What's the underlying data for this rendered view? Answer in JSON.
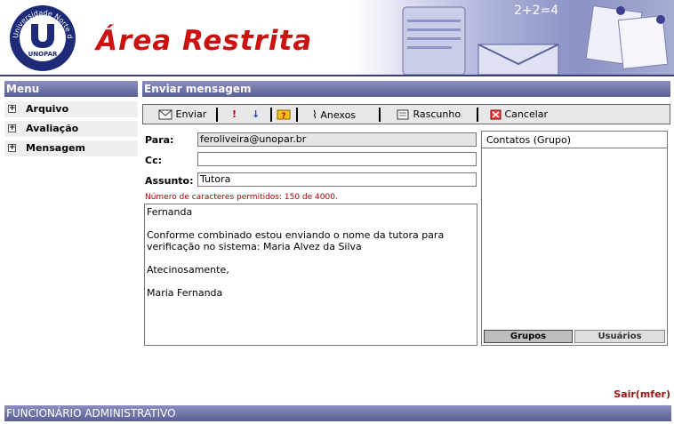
{
  "header": {
    "title": "Área Restrita",
    "logo": {
      "ring_text": "Universidade Norte do Paraná",
      "letter": "U",
      "name": "UNOPAR"
    }
  },
  "sidebar": {
    "title": "Menu",
    "items": [
      {
        "label": "Arquivo",
        "icon": "plus-box-icon"
      },
      {
        "label": "Avaliação",
        "icon": "plus-box-icon"
      },
      {
        "label": "Mensagem",
        "icon": "plus-box-icon"
      }
    ]
  },
  "section": {
    "title": "Enviar mensagem"
  },
  "toolbar": {
    "send_label": "Enviar",
    "attach_label": "Anexos",
    "draft_label": "Rascunho",
    "cancel_label": "Cancelar"
  },
  "form": {
    "to_label": "Para:",
    "to_value": "feroliveira@unopar.br",
    "cc_label": "Cc:",
    "cc_value": "",
    "subject_label": "Assunto:",
    "subject_value": "Tutora",
    "char_count": "Número de caracteres permitidos: 150 de 4000.",
    "body_lines": [
      "Fernanda",
      "",
      "Conforme combinado estou enviando o nome da tutora para",
      "verificação no sistema: Maria Alvez da Silva",
      "",
      "Atecinosamente,",
      "",
      "Maria Fernanda"
    ]
  },
  "contacts": {
    "title": "Contatos (Grupo)",
    "tab_groups": "Grupos",
    "tab_users": "Usuários"
  },
  "logout_label": "Sair(mfer)",
  "footer": {
    "role": "FUNCIONÁRIO ADMINISTRATIVO"
  },
  "colors": {
    "title_red": "#cc1111",
    "bar_purple": "#6a6fa5",
    "warning_red": "#aa0000"
  }
}
